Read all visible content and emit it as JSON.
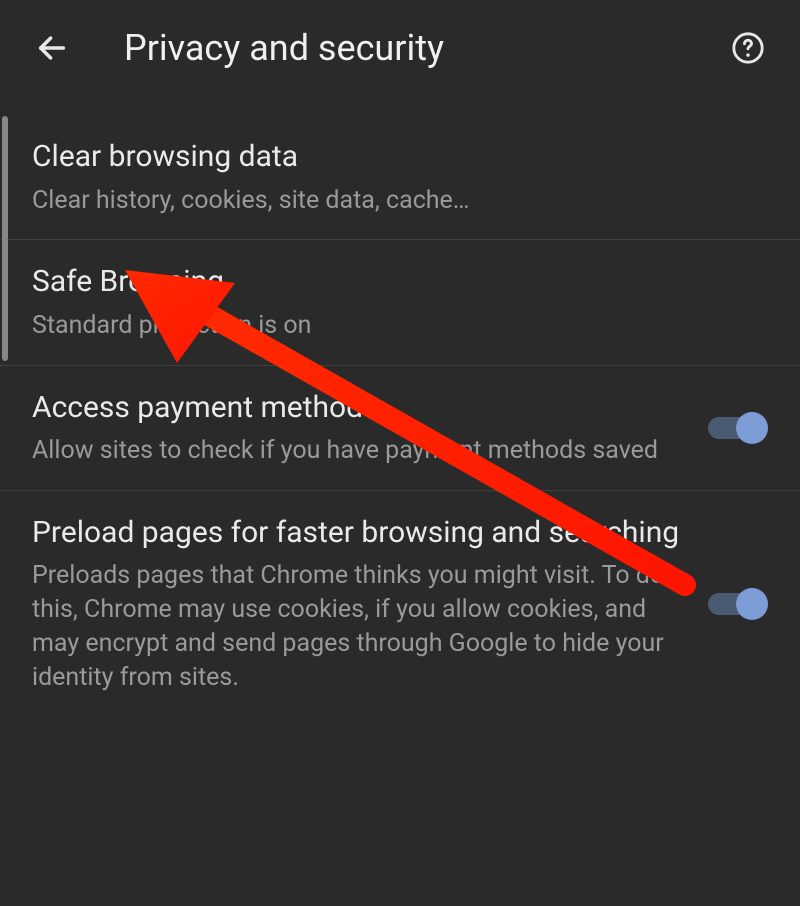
{
  "header": {
    "title": "Privacy and security"
  },
  "items": [
    {
      "title": "Clear browsing data",
      "desc": "Clear history, cookies, site data, cache…",
      "toggle": false
    },
    {
      "title": "Safe Browsing",
      "desc": "Standard protection is on",
      "toggle": false
    },
    {
      "title": "Access payment methods",
      "desc": "Allow sites to check if you have payment methods saved",
      "toggle": true
    },
    {
      "title": "Preload pages for faster browsing and searching",
      "desc": "Preloads pages that Chrome thinks you might visit. To do this, Chrome may use cookies, if you allow cookies, and may encrypt and send pages through Google to hide your identity from sites.",
      "toggle": true
    }
  ]
}
